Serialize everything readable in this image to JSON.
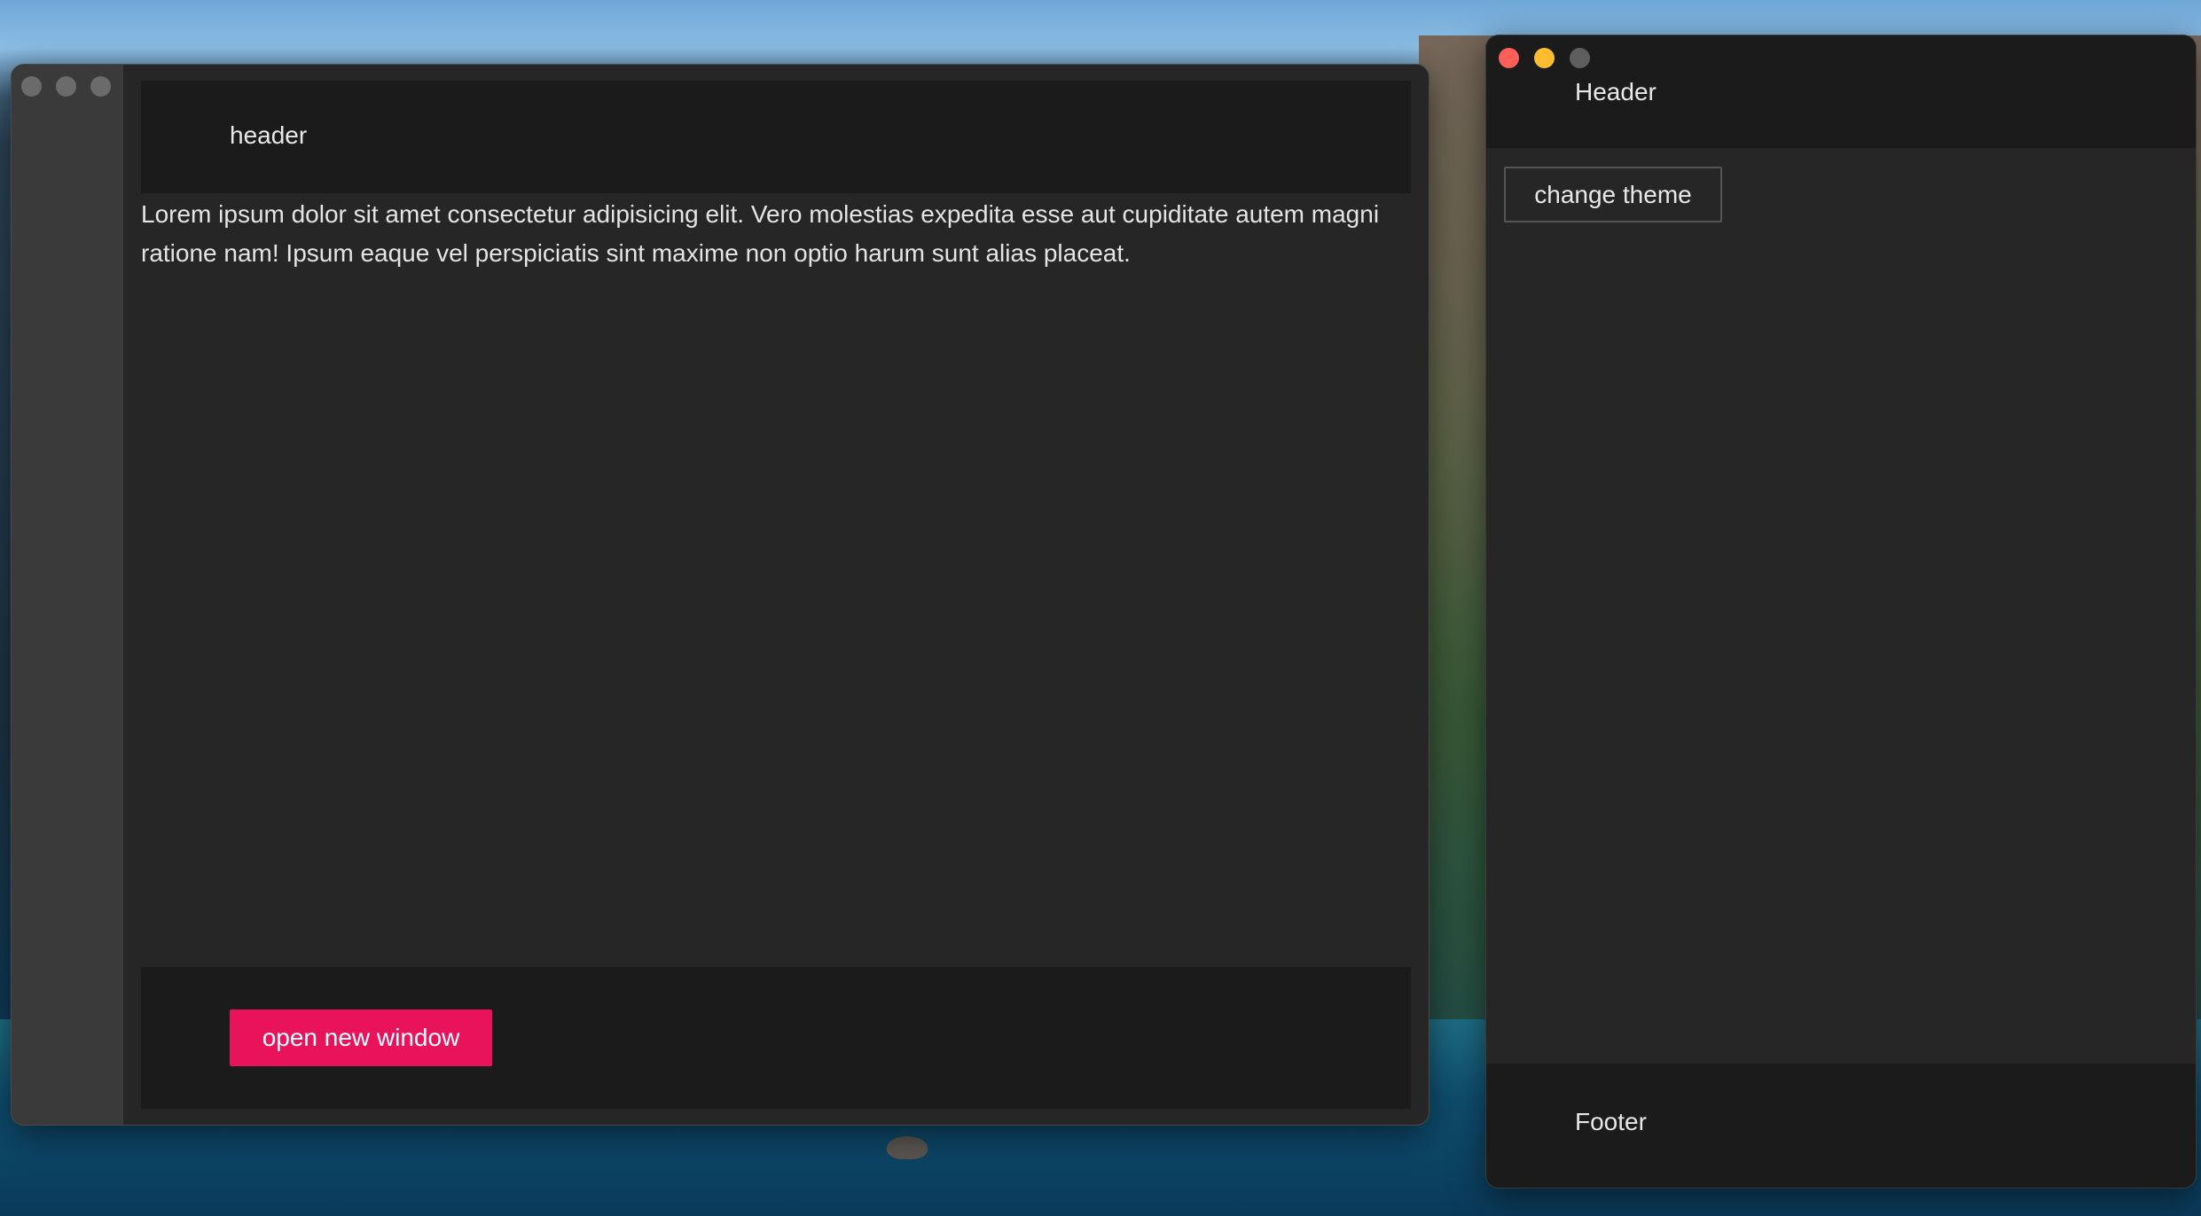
{
  "desktop": {
    "wallpaper_description_colors": {
      "sky": "#8cbde4",
      "ocean": "#0f4f70"
    }
  },
  "main_window": {
    "header": {
      "text": "header"
    },
    "content": {
      "paragraph": "Lorem ipsum dolor sit amet consectetur adipisicing elit. Vero molestias expedita esse aut cupiditate autem magni ratione nam! Ipsum eaque vel perspiciatis sint maxime non optio harum sunt alias placeat."
    },
    "footer": {
      "open_button_label": "open new window"
    },
    "colors": {
      "accent": "#e8135b",
      "background": "#262626",
      "bar": "#1b1b1b",
      "sidebar": "#3a3a3a"
    }
  },
  "second_window": {
    "header": {
      "text": "Header"
    },
    "theme_button_label": "change theme",
    "footer": {
      "text": "Footer"
    },
    "colors": {
      "close": "#fe5f57",
      "minimize": "#febc2e",
      "maximize": "#5e5e5e"
    }
  }
}
